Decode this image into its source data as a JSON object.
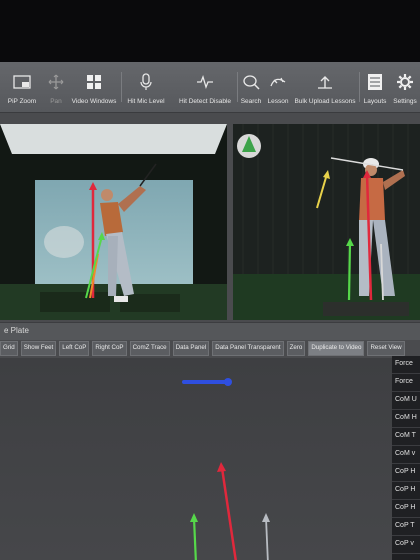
{
  "toolbar": {
    "items": [
      {
        "label": "PiP Zoom",
        "icon": "pip-zoom-icon"
      },
      {
        "label": "Pan",
        "icon": "pan-icon"
      },
      {
        "label": "Video Windows",
        "icon": "video-windows-icon"
      },
      {
        "label": "Hit Mic Level",
        "icon": "microphone-icon"
      },
      {
        "label": "Hit Detect Disable",
        "icon": "hit-detect-icon"
      },
      {
        "label": "Search",
        "icon": "search-icon"
      },
      {
        "label": "Lesson",
        "icon": "lesson-icon"
      },
      {
        "label": "Bulk Upload Lessons",
        "icon": "bulk-upload-icon"
      },
      {
        "label": "Layouts",
        "icon": "layouts-icon"
      },
      {
        "label": "Settings",
        "icon": "settings-icon"
      }
    ]
  },
  "panel": {
    "title": "e Plate"
  },
  "buttons": [
    "Grid",
    "Show Feet",
    "Left CoP",
    "Right CoP",
    "ComZ Trace",
    "Data Panel",
    "Data Panel Transparent",
    "Zero",
    "Duplicate to Video",
    "Reset View"
  ],
  "side_list": [
    "Force",
    "Force",
    "CoM U",
    "CoM H",
    "CoM T",
    "CoM v",
    "CoP H",
    "CoP H",
    "CoP H",
    "CoP T",
    "CoP v"
  ],
  "colors": {
    "force_red": "#e0283c",
    "force_green": "#56d84a",
    "force_yellow": "#e8d24a",
    "com_blue": "#2f4fe0",
    "accent_highlight": "#7c7f84"
  }
}
